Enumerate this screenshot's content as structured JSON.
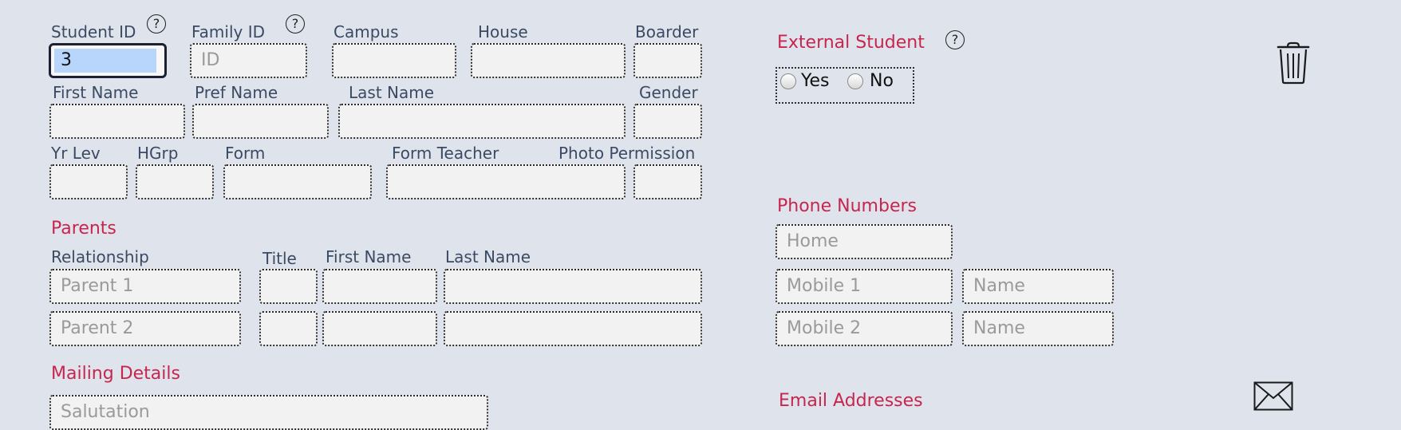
{
  "student": {
    "student_id_label": "Student ID",
    "student_id_value": "3",
    "family_id_label": "Family ID",
    "family_id_placeholder": "ID",
    "campus_label": "Campus",
    "house_label": "House",
    "boarder_label": "Boarder",
    "first_name_label": "First Name",
    "pref_name_label": "Pref Name",
    "last_name_label": "Last Name",
    "gender_label": "Gender",
    "yr_lev_label": "Yr Lev",
    "hgrp_label": "HGrp",
    "form_label": "Form",
    "form_teacher_label": "Form Teacher",
    "photo_permission_label": "Photo Permission",
    "help_glyph": "?"
  },
  "parents": {
    "heading": "Parents",
    "relationship_label": "Relationship",
    "title_label": "Title",
    "first_name_label": "First Name",
    "last_name_label": "Last Name",
    "parent1_placeholder": "Parent 1",
    "parent2_placeholder": "Parent 2"
  },
  "mailing": {
    "heading": "Mailing Details",
    "salutation_placeholder": "Salutation"
  },
  "external": {
    "heading": "External Student",
    "yes_label": "Yes",
    "no_label": "No"
  },
  "phones": {
    "heading": "Phone Numbers",
    "home_placeholder": "Home",
    "mobile1_placeholder": "Mobile 1",
    "mobile2_placeholder": "Mobile 2",
    "name_placeholder": "Name"
  },
  "email": {
    "heading": "Email Addresses"
  },
  "icons": {
    "delete": "trash-icon",
    "email": "envelope-icon",
    "help": "question-circle-icon"
  },
  "colors": {
    "background": "#dfe4ec",
    "section_heading": "#c8254e",
    "label": "#3b4a63",
    "selection": "#b8d6fb"
  }
}
